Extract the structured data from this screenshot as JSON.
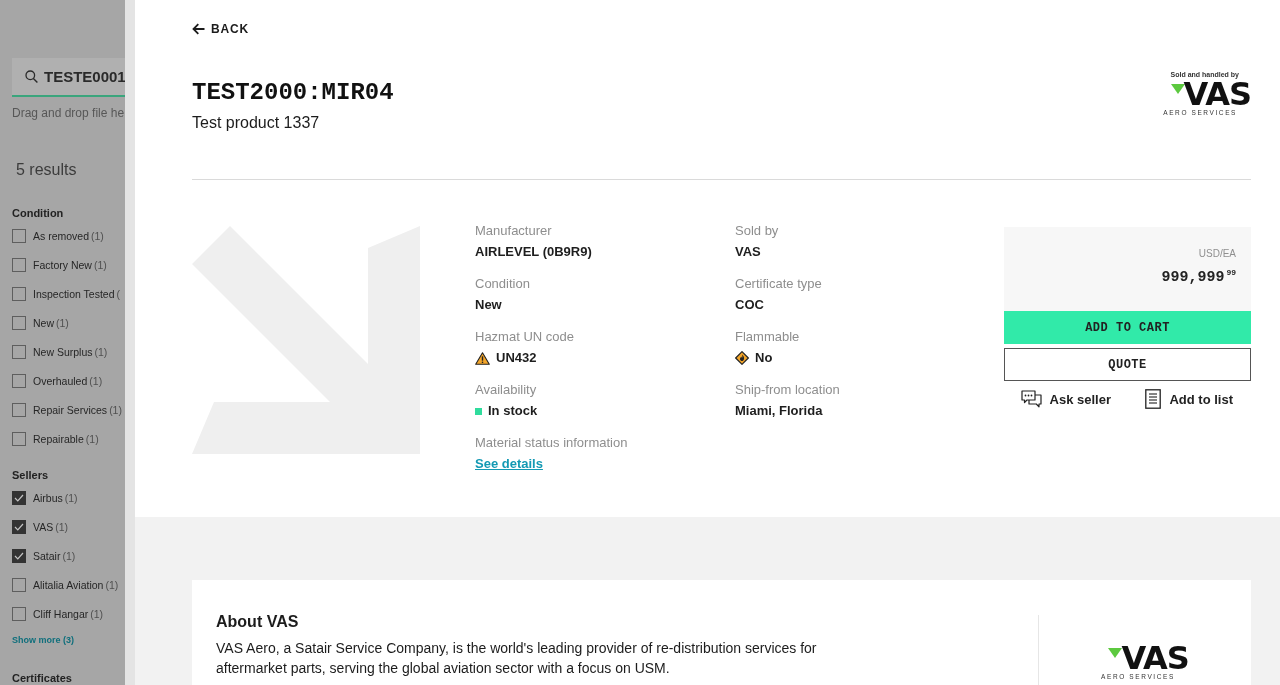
{
  "sidebar": {
    "search": {
      "value": "TESTE0001"
    },
    "dropzone_hint": "Drag and drop file he",
    "results": "5 results",
    "filter_groups": [
      {
        "title": "Condition",
        "options": [
          {
            "label": "As removed",
            "count": "(1)",
            "checked": false
          },
          {
            "label": "Factory New",
            "count": "(1)",
            "checked": false
          },
          {
            "label": "Inspection Tested",
            "count": "(",
            "checked": false
          },
          {
            "label": "New",
            "count": "(1)",
            "checked": false
          },
          {
            "label": "New Surplus",
            "count": "(1)",
            "checked": false
          },
          {
            "label": "Overhauled",
            "count": "(1)",
            "checked": false
          },
          {
            "label": "Repair Services",
            "count": "(1)",
            "checked": false
          },
          {
            "label": "Repairable",
            "count": "(1)",
            "checked": false
          }
        ]
      },
      {
        "title": "Sellers",
        "options": [
          {
            "label": "Airbus",
            "count": "(1)",
            "checked": true
          },
          {
            "label": "VAS",
            "count": "(1)",
            "checked": true
          },
          {
            "label": "Satair",
            "count": "(1)",
            "checked": true
          },
          {
            "label": "Alitalia Aviation",
            "count": "(1)",
            "checked": false
          },
          {
            "label": "Cliff Hangar",
            "count": "(1)",
            "checked": false
          }
        ],
        "show_more": "Show more (3)"
      },
      {
        "title": "Certificates"
      }
    ]
  },
  "back": "BACK",
  "product": {
    "part_number": "TEST2000:MIR04",
    "description": "Test product 1337"
  },
  "seller_logo": {
    "caption": "Sold and handled by",
    "name": "VAS",
    "tagline": "AERO SERVICES"
  },
  "details": [
    {
      "label": "Manufacturer",
      "value": "AIRLEVEL (0B9R9)",
      "kind": "text"
    },
    {
      "label": "Sold by",
      "value": "VAS",
      "kind": "text"
    },
    {
      "label": "Condition",
      "value": "New",
      "kind": "text"
    },
    {
      "label": "Certificate type",
      "value": "COC",
      "kind": "text"
    },
    {
      "label": "Hazmat UN code",
      "value": "UN432",
      "kind": "hazard"
    },
    {
      "label": "Flammable",
      "value": "No",
      "kind": "flammable"
    },
    {
      "label": "Availability",
      "value": "In stock",
      "kind": "stock"
    },
    {
      "label": "Ship-from location",
      "value": "Miami, Florida",
      "kind": "text"
    },
    {
      "label": "Material status information",
      "value": "See details",
      "kind": "link"
    }
  ],
  "price": {
    "unit": "USD/EA",
    "amount": "999,999",
    "cents": "99"
  },
  "actions": [
    {
      "label": "ADD TO CART",
      "kind": "primary"
    },
    {
      "label": "QUOTE",
      "kind": "secondary"
    }
  ],
  "links": [
    {
      "label": "Ask seller",
      "kind": "chat"
    },
    {
      "label": "Add to list",
      "kind": "list"
    }
  ],
  "about": {
    "title": "About VAS",
    "text": "VAS Aero, a Satair Service Company, is the world's leading provider of re-distribution services for aftermarket parts, serving the global aviation sector with a focus on USM.",
    "logo": {
      "name": "VAS",
      "tagline": "AERO SERVICES"
    }
  }
}
